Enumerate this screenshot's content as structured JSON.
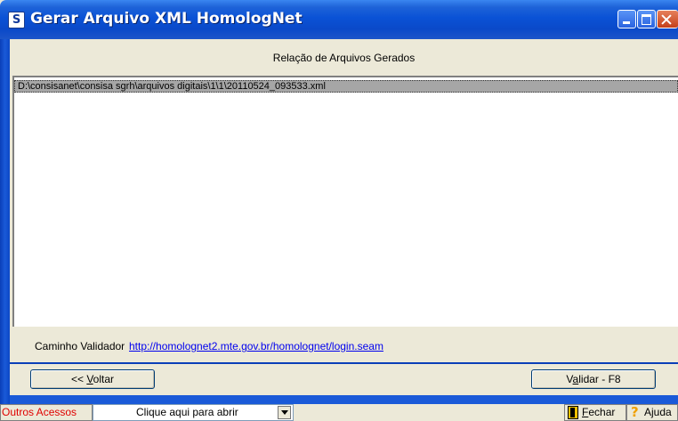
{
  "window": {
    "title": "Gerar Arquivo XML HomologNet",
    "app_icon_glyph": "S"
  },
  "header": {
    "title": "Relação de Arquivos Gerados"
  },
  "files": [
    "D:\\consisanet\\consisa sgrh\\arquivos digitais\\1\\1\\20110524_093533.xml"
  ],
  "validator": {
    "label": "Caminho Validador",
    "url": "http://homolognet2.mte.gov.br/homolognet/login.seam"
  },
  "buttons": {
    "back_prefix": "<< ",
    "back_mnemonic": "V",
    "back_rest": "oltar",
    "validate_prefix": "V",
    "validate_mnemonic": "a",
    "validate_rest": "lidar - F8"
  },
  "toolbar": {
    "outros_label": "Outros Acessos",
    "combo_value": "Clique aqui para abrir",
    "close_mnemonic": "F",
    "close_rest": "echar",
    "help_label": "Ajuda"
  },
  "colors": {
    "title_bar": "#0a52d6",
    "selected_row": "#a6a6a6",
    "link": "#0000ee",
    "outros_label": "#e00000"
  },
  "icons": [
    "app-icon",
    "minimize-icon",
    "maximize-icon",
    "close-icon",
    "door-icon",
    "help-icon",
    "chevron-down-icon"
  ]
}
